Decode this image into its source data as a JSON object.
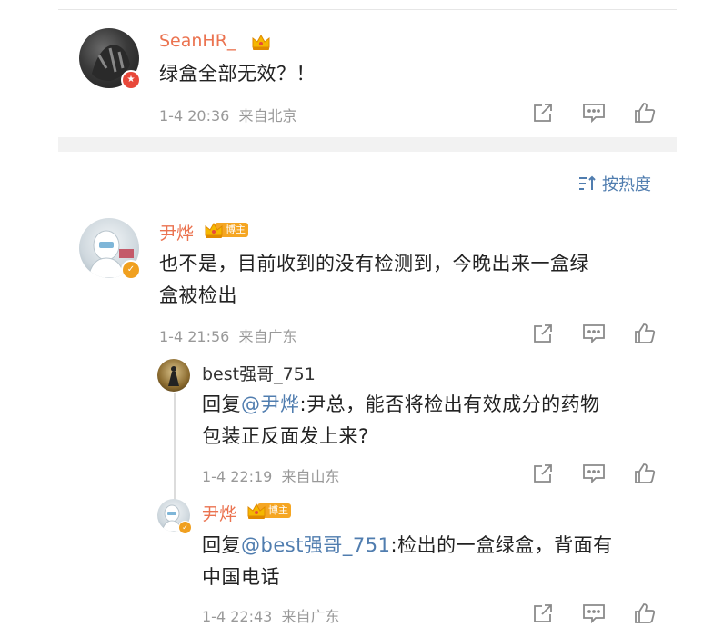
{
  "comments": [
    {
      "user": "SeanHR_",
      "text": "绿盒全部无效？！",
      "time": "1-4 20:36",
      "location": "来自北京",
      "badge_color": "#e8483a"
    },
    {
      "user": "尹烨",
      "tag": "博主",
      "text_line1": "也不是，目前收到的没有检测到，今晚出来一盒绿",
      "text_line2": "盒被检出",
      "time": "1-4 21:56",
      "location": "来自广东",
      "badge_color": "#f0a020"
    }
  ],
  "sort": {
    "label": "按热度",
    "icon": "sort-icon"
  },
  "replies": [
    {
      "user": "best强哥_751",
      "reply_prefix": "回复",
      "mention": "@尹烨",
      "line1_rest": ":尹总，能否将检出有效成分的药物",
      "line2": "包装正反面发上来?",
      "time": "1-4 22:19",
      "location": "来自山东"
    },
    {
      "user": "尹烨",
      "tag": "博主",
      "reply_prefix": "回复",
      "mention": "@best强哥_751",
      "line1_rest": ":检出的一盒绿盒，背面有",
      "line2": "中国电话",
      "time": "1-4 22:43",
      "location": "来自广东"
    }
  ],
  "icons": [
    "share-icon",
    "comment-icon",
    "like-icon"
  ],
  "colors": {
    "username": "#eb7350",
    "mention": "#507daf",
    "meta": "#999999"
  }
}
